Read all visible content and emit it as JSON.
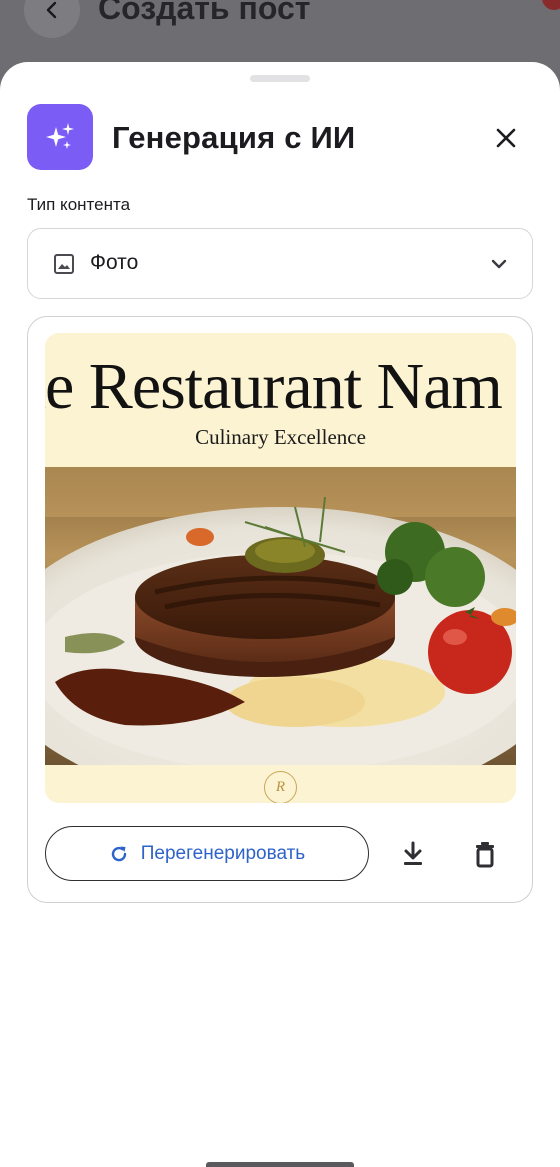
{
  "background_page": {
    "title": "Создать пост"
  },
  "sheet": {
    "title": "Генерация с ИИ",
    "content_type": {
      "label": "Тип контента",
      "selected": "Фото"
    },
    "preview": {
      "poster_name": "he Restaurant Nam",
      "poster_tagline": "Culinary Excellence",
      "logo_text": "R"
    },
    "actions": {
      "regenerate_label": "Перегенерировать"
    }
  },
  "icons": {
    "back": "chevron-left-icon",
    "ai": "sparkles-icon",
    "close": "close-icon",
    "image": "image-icon",
    "dropdown": "chevron-down-icon",
    "refresh": "refresh-icon",
    "download": "download-icon",
    "delete": "trash-icon"
  },
  "colors": {
    "accent_purple": "#7b5cf5",
    "link_blue": "#2e63c9",
    "poster_bg": "#fbf3d2"
  }
}
